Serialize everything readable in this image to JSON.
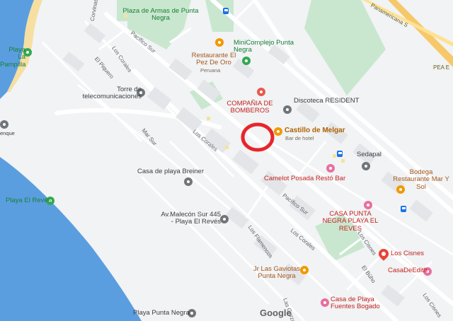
{
  "map": {
    "water_color": "#5b9ee0",
    "land_color": "#f1f3f4",
    "park_color": "#c9e7cf",
    "highlight_circle_color": "#e8252b",
    "attribution": "Google"
  },
  "labels": {
    "plaza": "Plaza de Armas de Punta Negra",
    "minicomplejo": "MiniComplejo Punta Negra",
    "restaurante_pez": "Restaurante El Pez De Oro",
    "restaurante_pez_sub": "Peruana",
    "playa_la_pampilla": "Playa La Pampilla",
    "torre": "Torre de telecomunicaciones",
    "compania": "COMPAÑIA DE BOMBEROS",
    "discoteca": "Discoteca RESIDENT",
    "castillo": "Castillo de Melgar",
    "castillo_sub": "Bar de hotel",
    "sedapal": "Sedapal",
    "bodega": "Bodega Restaurante Mar Y Sol",
    "casa_breiner": "Casa de playa Breiner",
    "camelot": "Camelot Posada Restó Bar",
    "playa_el_reves": "Playa El Revés",
    "av_malecon": "Av.Malecón Sur 445 - Playa El Revés",
    "casa_punta_negra": "CASA PUNTA NEGRA PLAYA EL REVES",
    "los_cisnes": "Los Cisnes",
    "casadeedith": "CasaDeEdith",
    "jr_gaviotas": "Jr Las Gaviotas Punta Negra",
    "casa_fuentes": "Casa de Playa Fuentes Bogado",
    "playa_punta_negra": "Playa Punta Negra",
    "panamericana": "Panamericana S",
    "pea_e": "PEA E",
    "enque": "enque",
    "streets": {
      "los_corales_top": "Los Corales",
      "el_piquero": "El Piquero",
      "pacifico_sur_top": "Pacífico Sur",
      "mar_sur": "Mar Sur",
      "los_corales_mid": "Los Corales",
      "pacifico_sur_mid": "Pacífico Sur",
      "los_flamencos": "Los Flamencos",
      "los_corales_low": "Los Corales",
      "los_cisnes_st": "Los Cisnes",
      "el_buho": "El Búho",
      "corvinas": "Corvinas",
      "las_garzas": "Las Garzas",
      "los_cisnes_low": "Los Cisnes"
    }
  }
}
